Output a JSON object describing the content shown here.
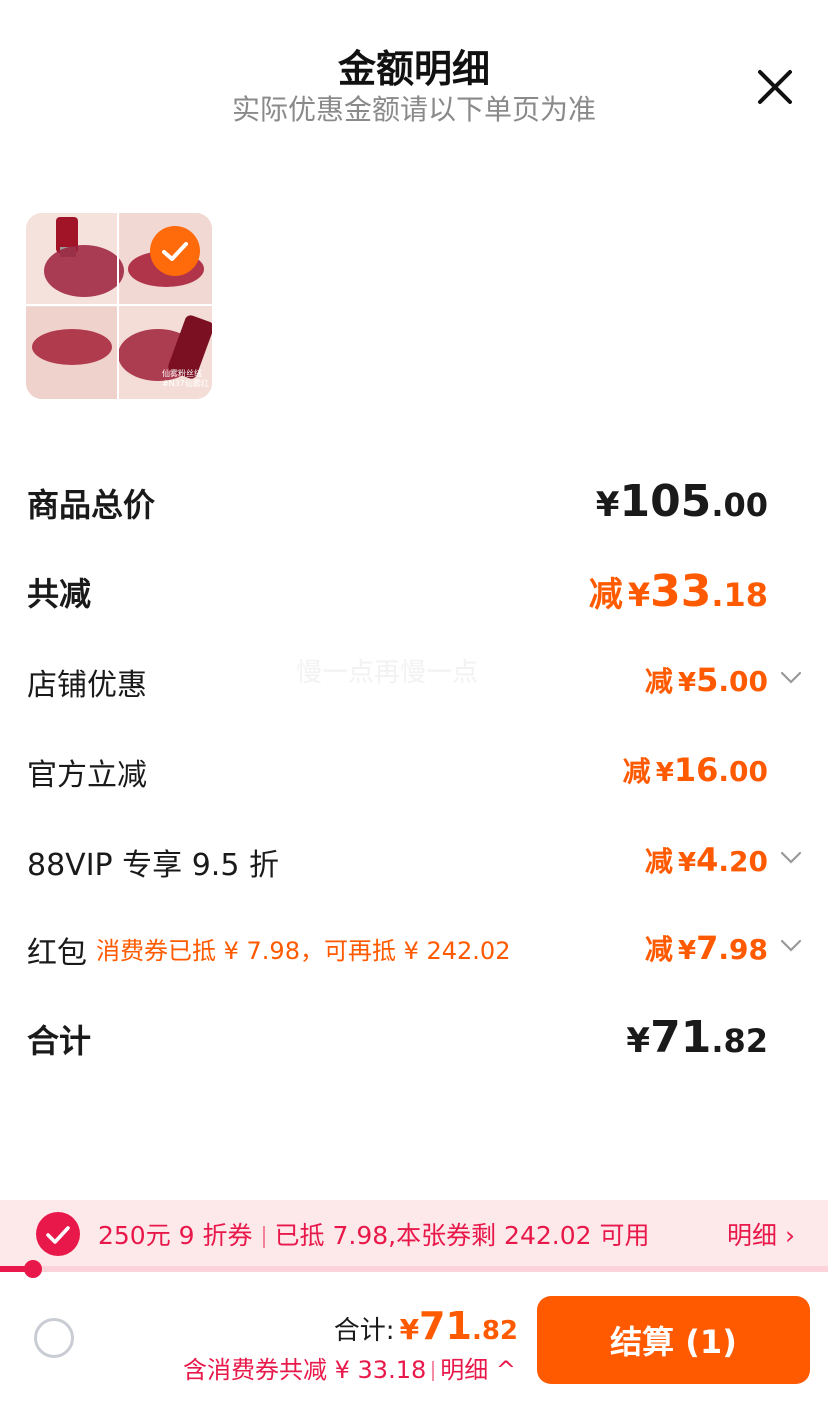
{
  "header": {
    "title": "金额明细",
    "subtitle": "实际优惠金额请以下单页为准"
  },
  "product": {
    "selected": true,
    "thumbnail_caption_line1": "仙雾粉丝绒",
    "thumbnail_caption_line2": "#N37仙雾红"
  },
  "watermark": "慢一点再慢一点",
  "rows": {
    "subtotal": {
      "label": "商品总价",
      "yen": "¥",
      "int": "105",
      "dec": ".00"
    },
    "total_reduction": {
      "label": "共减",
      "prefix": "减",
      "yen": "¥",
      "int": "33",
      "dec": ".18"
    },
    "shop_discount": {
      "label": "店铺优惠",
      "prefix": "减",
      "yen": "¥",
      "int": "5",
      "dec": ".00"
    },
    "official_discount": {
      "label": "官方立减",
      "prefix": "减",
      "yen": "¥",
      "int": "16",
      "dec": ".00"
    },
    "vip_discount": {
      "label": "88VIP 专享 9.5 折",
      "prefix": "减",
      "yen": "¥",
      "int": "4",
      "dec": ".20"
    },
    "red_packet": {
      "label": "红包",
      "note": "消费券已抵 ¥ 7.98，可再抵 ¥ 242.02",
      "prefix": "减",
      "yen": "¥",
      "int": "7",
      "dec": ".98"
    },
    "grand_total": {
      "label": "合计",
      "yen": "¥",
      "int": "71",
      "dec": ".82"
    }
  },
  "coupon_banner": {
    "selected": true,
    "name": "250元 9 折券",
    "status": "已抵 7.98,本张券剩 242.02 可用",
    "detail_label": "明细 ›",
    "progress": 0.04
  },
  "footer": {
    "total_label": "合计:",
    "total_yen": "¥",
    "total_int": "71",
    "total_dec": ".82",
    "summary": "含消费券共减 ¥ 33.18",
    "detail_label": "明细 ^",
    "checkout_label": "结算 (1)"
  },
  "colors": {
    "accent_orange": "#ff5a00",
    "coupon_red": "#e8194a",
    "banner_bg": "#fde8ea"
  }
}
